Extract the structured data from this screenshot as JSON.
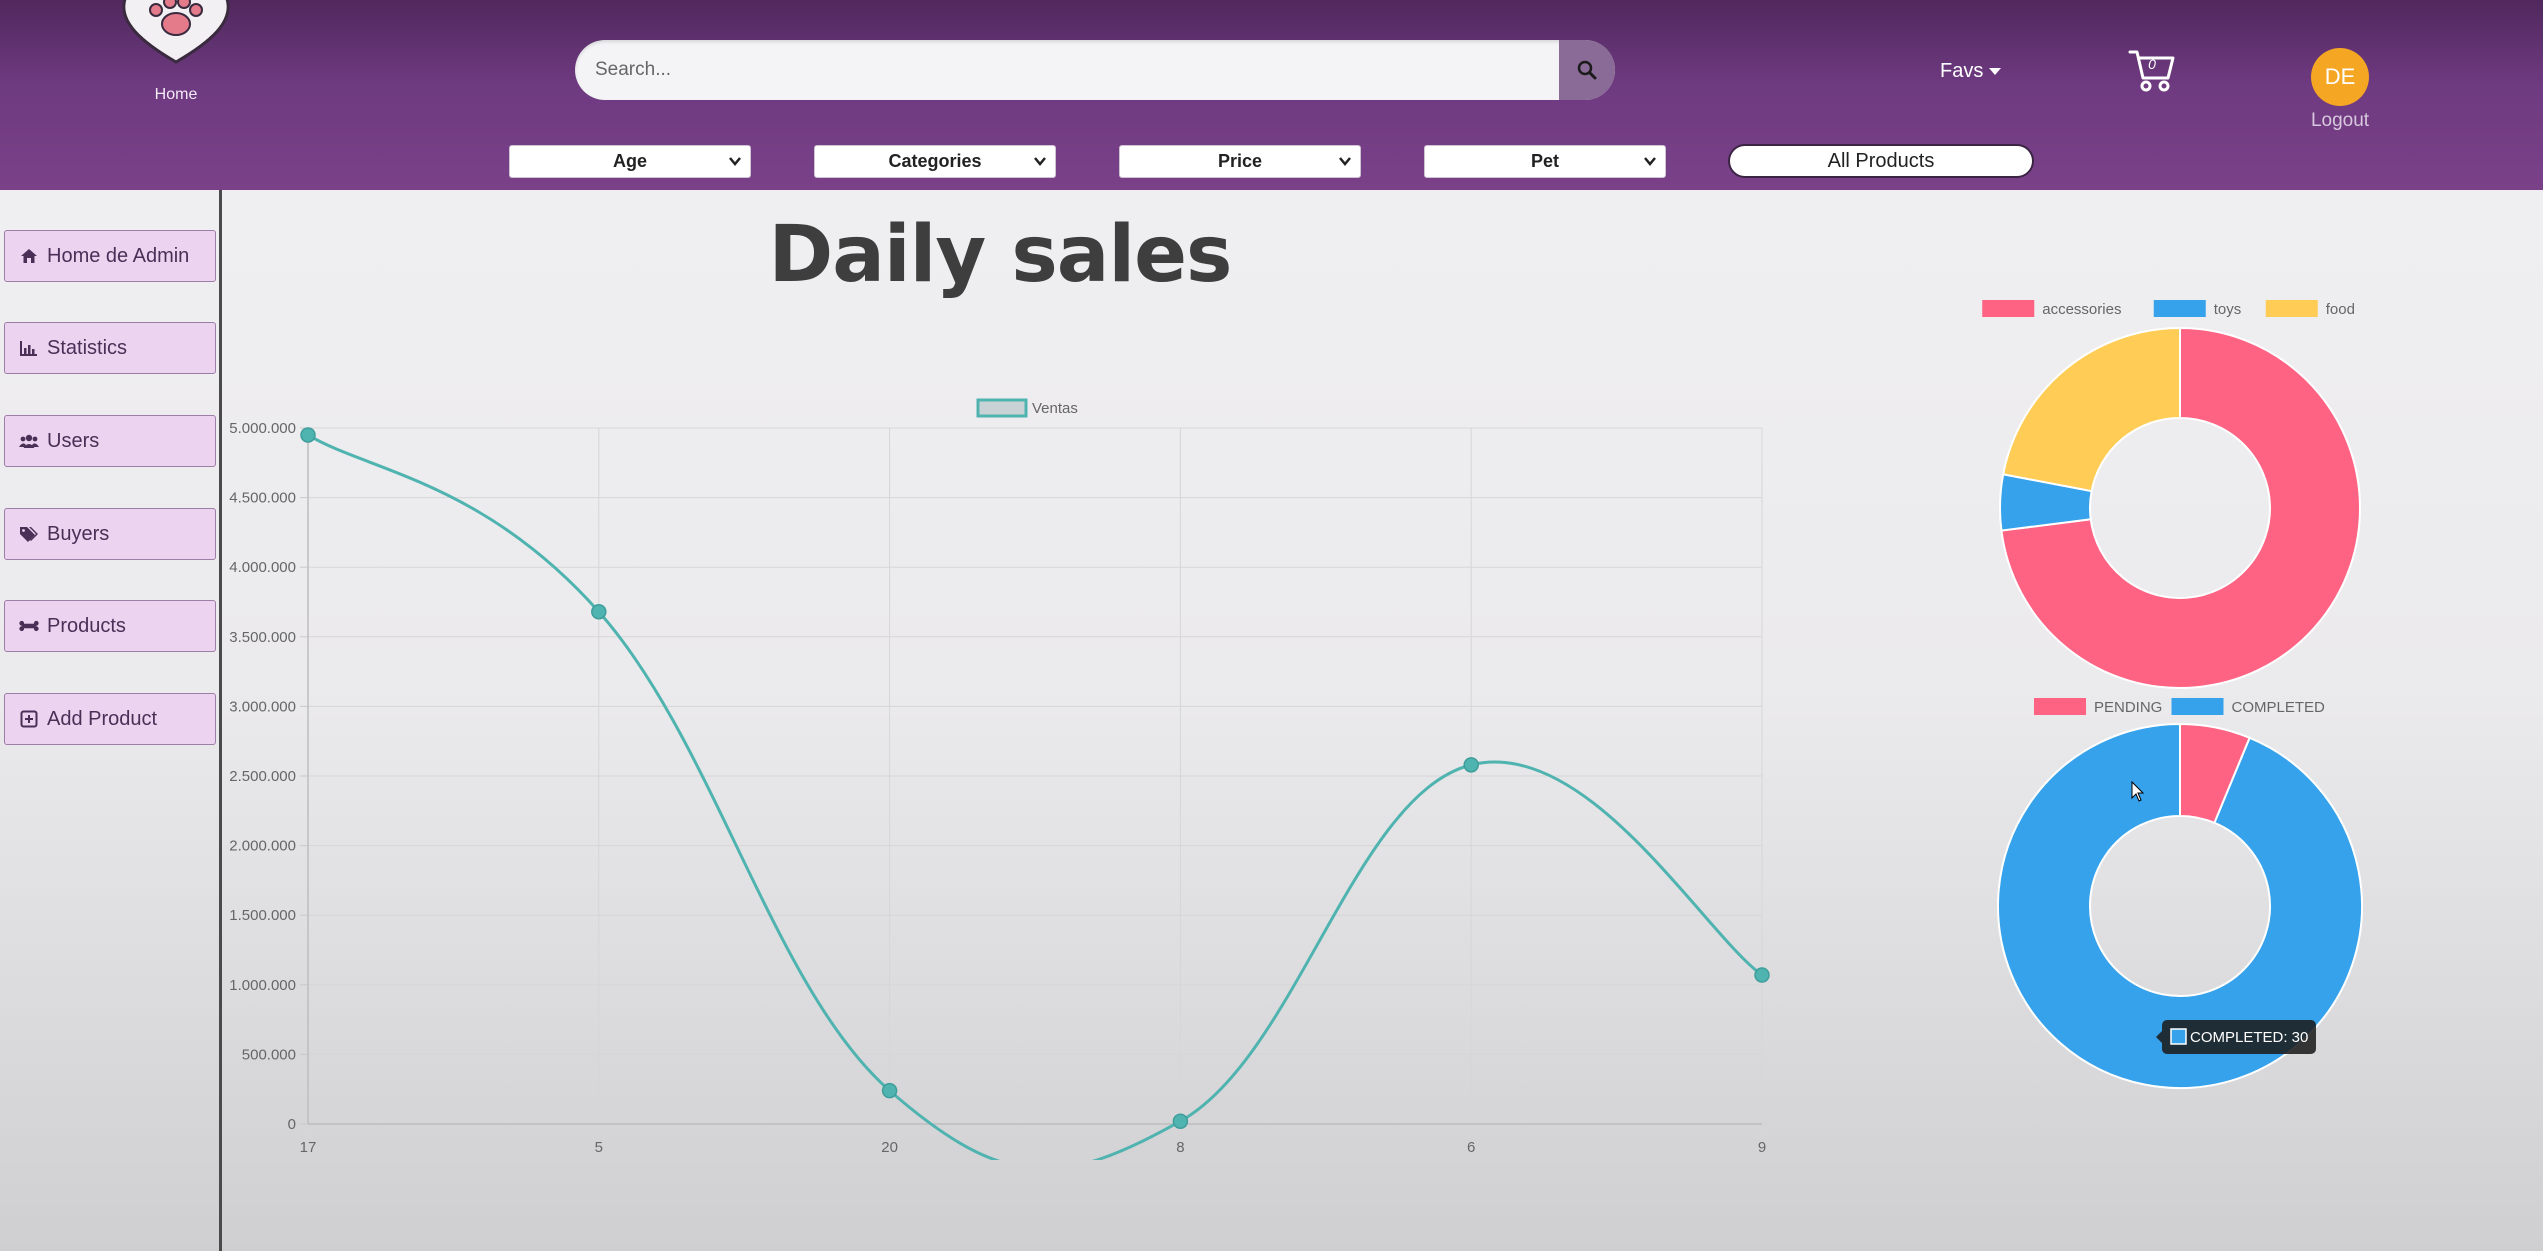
{
  "header": {
    "home_label": "Home",
    "search_placeholder": "Search...",
    "favs_label": "Favs",
    "cart_count": "0",
    "avatar_initials": "DE",
    "logout_label": "Logout",
    "filters": [
      "Age",
      "Categories",
      "Price",
      "Pet"
    ],
    "all_products_label": "All Products",
    "colors": {
      "header_top": "#51285e",
      "header_bottom": "#7a4189",
      "avatar": "#f5a623"
    }
  },
  "sidebar": {
    "items": [
      {
        "label": "Home de Admin",
        "icon": "home-icon"
      },
      {
        "label": "Statistics",
        "icon": "chart-icon"
      },
      {
        "label": "Users",
        "icon": "users-icon"
      },
      {
        "label": "Buyers",
        "icon": "tags-icon"
      },
      {
        "label": "Products",
        "icon": "bone-icon"
      },
      {
        "label": "Add Product",
        "icon": "plus-square-icon"
      }
    ]
  },
  "main": {
    "title": "Daily sales"
  },
  "chart_data": [
    {
      "type": "line",
      "legend": [
        "Ventas"
      ],
      "categories": [
        "17",
        "5",
        "20",
        "8",
        "6",
        "9"
      ],
      "series": [
        {
          "name": "Ventas",
          "values": [
            4950000,
            3680000,
            240000,
            20000,
            2580000,
            1070000
          ],
          "color": "#4fb3b0"
        }
      ],
      "y_ticks": [
        "0",
        "500.000",
        "1.000.000",
        "1.500.000",
        "2.000.000",
        "2.500.000",
        "3.000.000",
        "3.500.000",
        "4.000.000",
        "4.500.000",
        "5.000.000"
      ],
      "ylim": [
        0,
        5000000
      ],
      "grid": true,
      "legend_position": "top"
    },
    {
      "type": "pie",
      "labels": [
        "accessories",
        "toys",
        "food"
      ],
      "values": [
        73,
        5,
        22
      ],
      "colors": [
        "#ff6384",
        "#36a2eb",
        "#ffcd56"
      ],
      "legend_position": "top"
    },
    {
      "type": "pie",
      "labels": [
        "PENDING",
        "COMPLETED"
      ],
      "values": [
        2,
        30
      ],
      "colors": [
        "#ff6384",
        "#36a2eb"
      ],
      "legend_position": "top",
      "tooltip": "COMPLETED: 30"
    }
  ]
}
